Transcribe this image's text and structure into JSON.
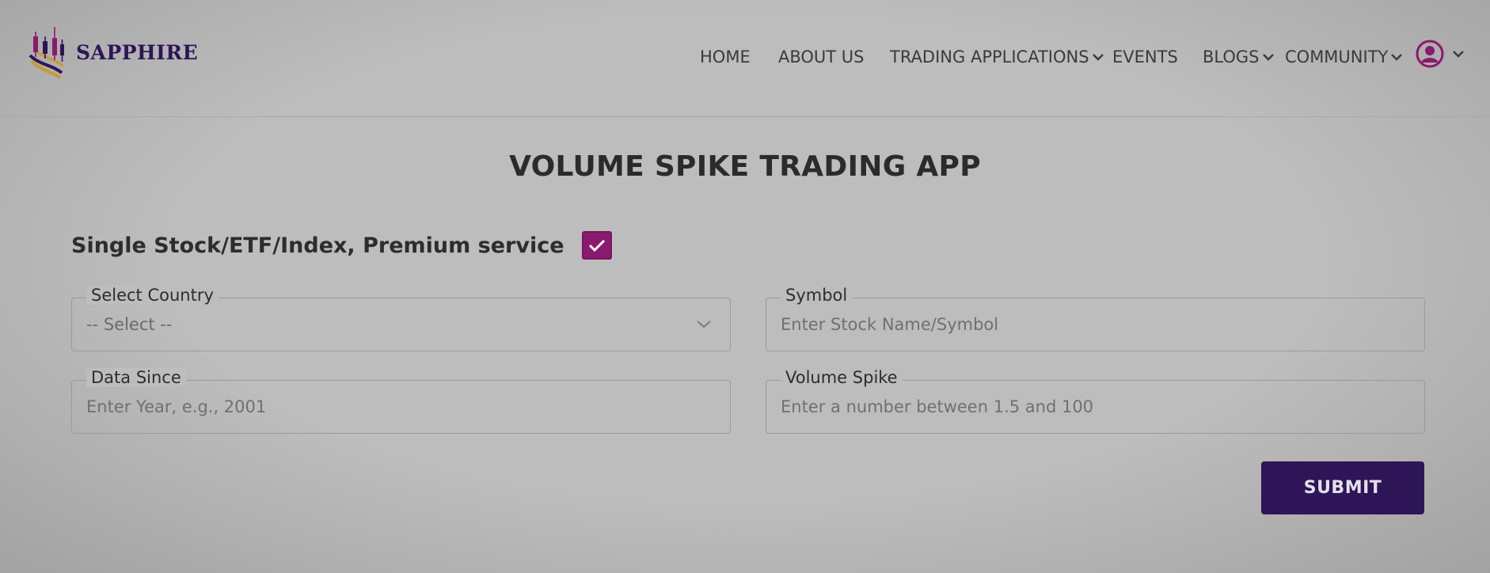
{
  "brand": {
    "name": "SAPPHIRE",
    "logo_icon": "candlestick-logo-icon"
  },
  "nav": {
    "items": [
      {
        "label": "HOME",
        "has_dropdown": false
      },
      {
        "label": "ABOUT US",
        "has_dropdown": false
      },
      {
        "label": "TRADING APPLICATIONS",
        "has_dropdown": true
      },
      {
        "label": "EVENTS",
        "has_dropdown": false
      },
      {
        "label": "BLOGS",
        "has_dropdown": true
      },
      {
        "label": "COMMUNITY",
        "has_dropdown": true
      }
    ],
    "user_icon": "user-avatar-icon"
  },
  "page": {
    "title": "VOLUME SPIKE TRADING APP"
  },
  "premium": {
    "label": "Single Stock/ETF/Index, Premium service",
    "checked": true
  },
  "form": {
    "country": {
      "legend": "Select Country",
      "value": "-- Select --"
    },
    "symbol": {
      "legend": "Symbol",
      "placeholder": "Enter Stock Name/Symbol"
    },
    "data_since": {
      "legend": "Data Since",
      "placeholder": "Enter Year, e.g., 2001"
    },
    "volume_spike": {
      "legend": "Volume Spike",
      "placeholder": "Enter a number between 1.5 and 100"
    },
    "submit_label": "SUBMIT"
  },
  "colors": {
    "accent": "#8a1a6e",
    "brand": "#2e1557",
    "logo_gold": "#c99a2e",
    "background": "#bdbdbd"
  }
}
